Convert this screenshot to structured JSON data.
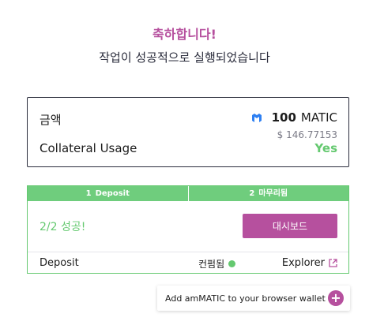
{
  "header": {
    "title": "축하합니다!",
    "subtitle": "작업이 성공적으로 실행되었습니다"
  },
  "summary": {
    "amount_label": "금액",
    "token_icon": "matic-icon",
    "amount_value": "100",
    "amount_symbol": "MATIC",
    "amount_usd": "$ 146.77153",
    "collateral_label": "Collateral Usage",
    "collateral_value": "Yes"
  },
  "steps": {
    "tabs": [
      {
        "num": "1",
        "label": "Deposit"
      },
      {
        "num": "2",
        "label": "마무리됨"
      }
    ],
    "status_text": "2/2 성공!",
    "dashboard_button": "대시보드",
    "footer": {
      "deposit_label": "Deposit",
      "confirmed_label": "컨펌됨",
      "explorer_label": "Explorer"
    }
  },
  "wallet": {
    "add_label": "Add amMATIC to your browser wallet",
    "plus_symbol": "+"
  },
  "colors": {
    "accent": "#b6509e",
    "success": "#65c970",
    "step_header": "#6fcd7d",
    "text": "#2b2d3c"
  }
}
